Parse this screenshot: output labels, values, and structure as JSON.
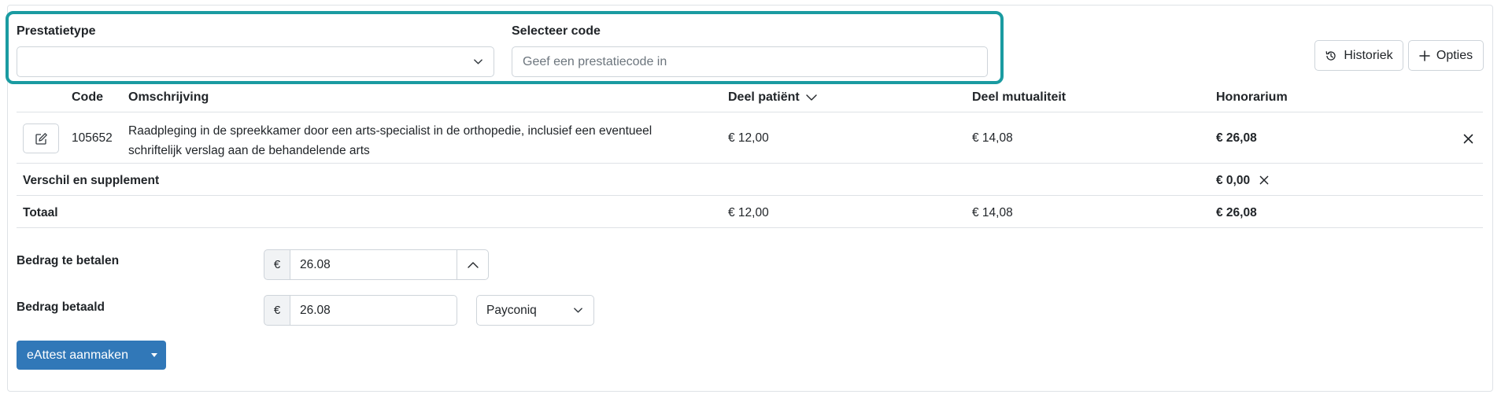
{
  "filters": {
    "prestatietype_label": "Prestatietype",
    "prestatietype_value": "",
    "code_label": "Selecteer code",
    "code_placeholder": "Geef een prestatiecode in"
  },
  "toolbar": {
    "historiek_label": "Historiek",
    "opties_label": "Opties"
  },
  "table": {
    "headers": {
      "code": "Code",
      "omschrijving": "Omschrijving",
      "deel_patient": "Deel patiënt",
      "deel_mutualiteit": "Deel mutualiteit",
      "honorarium": "Honorarium"
    },
    "rows": [
      {
        "code": "105652",
        "omschrijving_line1": "Raadpleging in de spreekkamer door een arts-specialist in de orthopedie, inclusief een eventueel",
        "omschrijving_line2": "schriftelijk verslag aan de behandelende arts",
        "deel_patient": "€ 12,00",
        "deel_mutualiteit": "€ 14,08",
        "honorarium": "€ 26,08"
      }
    ],
    "supplement": {
      "label": "Verschil en supplement",
      "honorarium": "€ 0,00"
    },
    "totaal": {
      "label": "Totaal",
      "deel_patient": "€ 12,00",
      "deel_mutualiteit": "€ 14,08",
      "honorarium": "€ 26,08"
    }
  },
  "payment": {
    "te_betalen_label": "Bedrag te betalen",
    "te_betalen_currency": "€",
    "te_betalen_value": "26.08",
    "betaald_label": "Bedrag betaald",
    "betaald_currency": "€",
    "betaald_value": "26.08",
    "method_value": "Payconiq"
  },
  "actions": {
    "eattest_label": "eAttest aanmaken"
  },
  "colors": {
    "highlight": "#1a9ba1",
    "primary": "#3178b8"
  }
}
